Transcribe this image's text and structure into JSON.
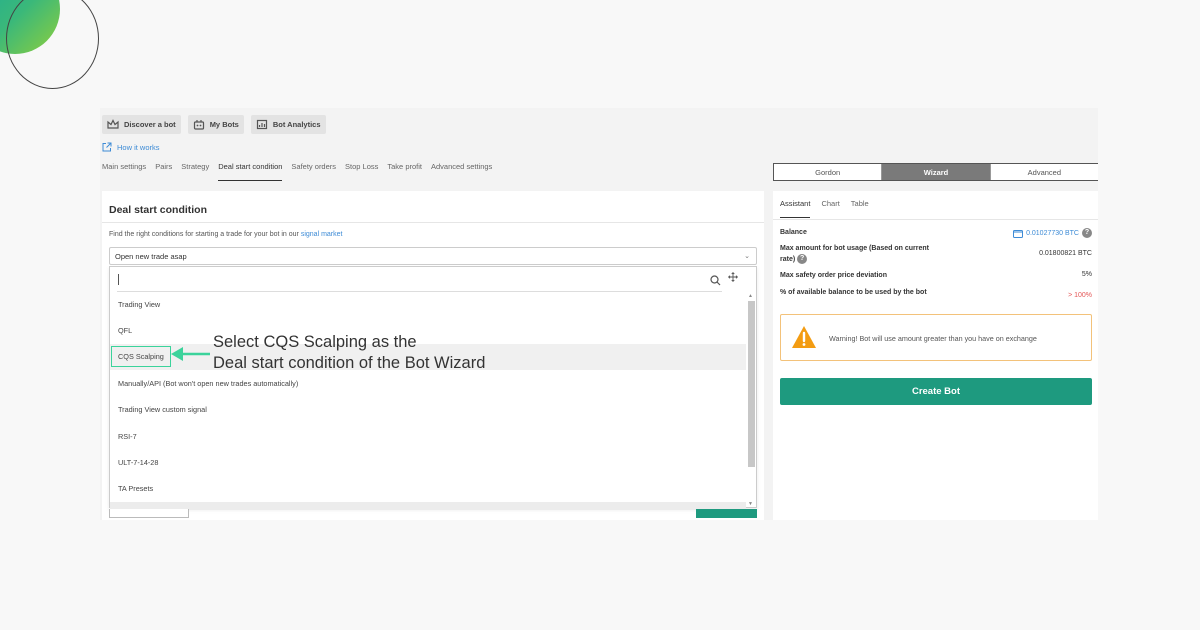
{
  "colors": {
    "accent": "#1e9a7f",
    "link": "#3d8bd6",
    "warning": "#f39c12",
    "highlight": "#3bd39b"
  },
  "topnav": [
    {
      "label": "Discover a bot",
      "icon": "crown-icon"
    },
    {
      "label": "My Bots",
      "icon": "robot-icon"
    },
    {
      "label": "Bot Analytics",
      "icon": "chart-icon"
    }
  ],
  "how_it_works": "How it works",
  "subtabs": [
    "Main settings",
    "Pairs",
    "Strategy",
    "Deal start condition",
    "Safety orders",
    "Stop Loss",
    "Take profit",
    "Advanced settings"
  ],
  "active_subtab": "Deal start condition",
  "mode_tabs": [
    "Gordon",
    "Wizard",
    "Advanced"
  ],
  "active_mode": "Wizard",
  "deal": {
    "title": "Deal start condition",
    "desc_prefix": "Find the right conditions for starting a trade for your bot in our",
    "desc_link": "signal market",
    "selected": "Open new trade asap",
    "search_value": "",
    "options": [
      "Trading View",
      "QFL",
      "CQS Scalping",
      "Manually/API (Bot won't open new trades automatically)",
      "Trading View custom signal",
      "RSI-7",
      "ULT-7-14-28",
      "TA Presets"
    ]
  },
  "annotation": {
    "line1": "Select CQS Scalping as the",
    "line2": "Deal start condition of the Bot Wizard"
  },
  "right": {
    "tabs": [
      "Assistant",
      "Chart",
      "Table"
    ],
    "active_tab": "Assistant",
    "balance_label": "Balance",
    "balance_value": "0.01027730 BTC",
    "max_amount_label": "Max amount for bot usage (Based on current rate)",
    "max_amount_value": "0.01800821 BTC",
    "max_safety_label": "Max safety order price deviation",
    "max_safety_value": "5%",
    "pct_label": "% of available balance to be used by the bot",
    "pct_value": "> 100%",
    "warning": "Warning! Bot will use amount greater than you have on exchange",
    "create_button": "Create Bot"
  }
}
